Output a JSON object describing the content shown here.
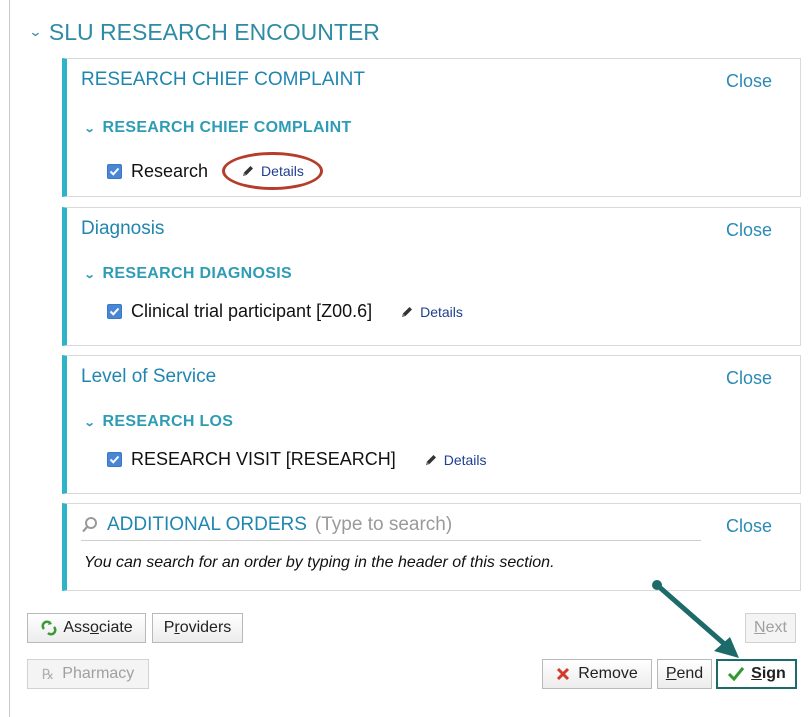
{
  "encounter": {
    "title": "SLU RESEARCH ENCOUNTER"
  },
  "panels": [
    {
      "title": "RESEARCH CHIEF COMPLAINT",
      "close": "Close",
      "subtitle": "RESEARCH CHIEF COMPLAINT",
      "item": "Research",
      "details": "Details",
      "checked": true
    },
    {
      "title": "Diagnosis",
      "close": "Close",
      "subtitle": "RESEARCH DIAGNOSIS",
      "item": "Clinical trial participant [Z00.6]",
      "details": "Details",
      "checked": true
    },
    {
      "title": "Level of Service",
      "close": "Close",
      "subtitle": "RESEARCH LOS",
      "item": "RESEARCH VISIT [RESEARCH]",
      "details": "Details",
      "checked": true
    }
  ],
  "additional_orders": {
    "title": "ADDITIONAL ORDERS",
    "placeholder": "(Type to search)",
    "close": "Close",
    "hint": "You can search for an order by typing in the header of this section."
  },
  "buttons": {
    "associate": {
      "pre": "Ass",
      "u": "o",
      "post": "ciate"
    },
    "providers": {
      "pre": "P",
      "u": "r",
      "post": "oviders"
    },
    "next": {
      "u": "N",
      "post": "ext"
    },
    "pharmacy": "Pharmacy",
    "remove": "Remove",
    "pend": {
      "u": "P",
      "post": "end"
    },
    "sign": {
      "u": "S",
      "post": "ign"
    }
  },
  "colors": {
    "accent": "#2fb3c9",
    "link": "#1f86b0",
    "annotation_circle": "#b53d2b",
    "annotation_arrow": "#1c6a6a"
  }
}
